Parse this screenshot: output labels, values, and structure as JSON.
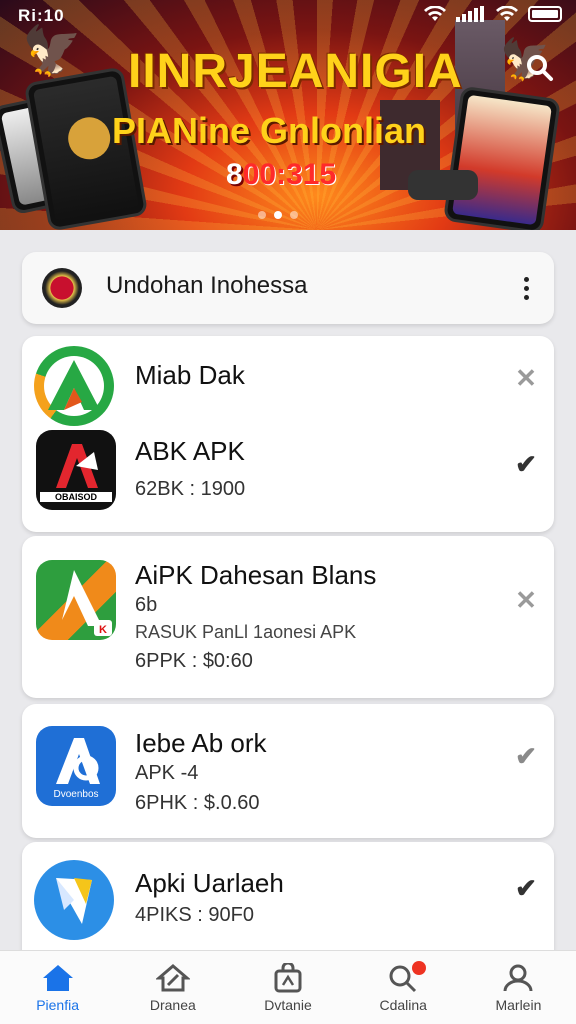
{
  "status_bar": {
    "time": "Ri:10"
  },
  "banner": {
    "headline1": "IINRJEANIGIA",
    "headline2": "PIANine Gnlonlian",
    "headline3_prefix": "8",
    "headline3_amount": "00:315",
    "slides": 3,
    "active_slide": 1
  },
  "header": {
    "title": "Undohan Inohessa"
  },
  "apps": [
    {
      "name": "Miab Dak"
    },
    {
      "name": "ABK APK",
      "sub1": "62BK : 1900",
      "icon_text": "OBAISOD"
    },
    {
      "name": "AiPK Dahesan Blans",
      "sub1": "6b",
      "sub2": "RASUK PanLl 1aonesi APK",
      "sub3": "6PPK : $0:60"
    },
    {
      "name": "Iebe Ab ork",
      "sub1": "APK -4",
      "sub2": "6PHK : $.0.60",
      "icon_text": "Dvoenbos"
    },
    {
      "name": "Apki Uarlaeh",
      "sub1": "4PIKS : 90F0"
    }
  ],
  "nav": [
    {
      "label": "Pienfia",
      "active": true
    },
    {
      "label": "Dranea"
    },
    {
      "label": "Dvtanie"
    },
    {
      "label": "Cdalina",
      "badge": true
    },
    {
      "label": "Marlein"
    }
  ],
  "colors": {
    "accent": "#1a73e8",
    "banner_gold": "#ffd21a",
    "badge": "#ee3322"
  }
}
